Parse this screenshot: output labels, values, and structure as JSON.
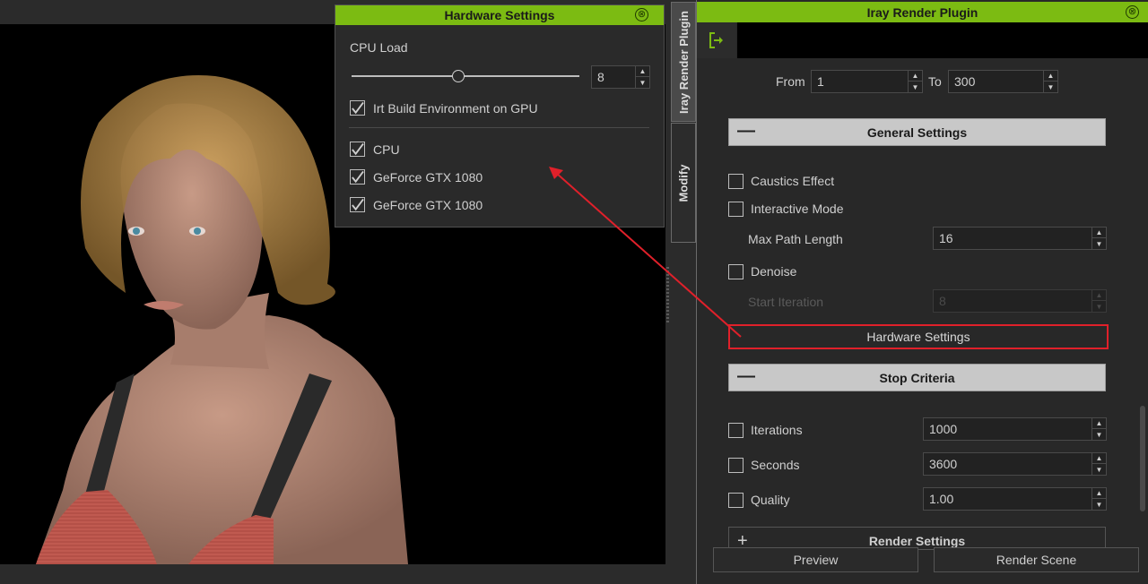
{
  "viewport": {
    "label": "3D viewport"
  },
  "side_tabs": [
    {
      "label": "Iray Render Plugin",
      "active": true
    },
    {
      "label": "Modify",
      "active": false
    }
  ],
  "plugin_panel": {
    "title": "Iray Render Plugin",
    "close_icon": "⊗",
    "exit_icon": "exit-arrow-icon",
    "frame_range": {
      "from_label": "From",
      "from_value": "1",
      "to_label": "To",
      "to_value": "300"
    },
    "general_settings": {
      "title": "General Settings",
      "toggle": "—",
      "caustics_label": "Caustics Effect",
      "caustics_checked": false,
      "interactive_label": "Interactive Mode",
      "interactive_checked": false,
      "max_path_label": "Max Path Length",
      "max_path_value": "16",
      "denoise_label": "Denoise",
      "denoise_checked": false,
      "start_iteration_label": "Start Iteration",
      "start_iteration_value": "8",
      "hardware_button": "Hardware Settings"
    },
    "stop_criteria": {
      "title": "Stop Criteria",
      "toggle": "—",
      "rows": [
        {
          "label": "Iterations",
          "value": "1000",
          "checked": false
        },
        {
          "label": "Seconds",
          "value": "3600",
          "checked": false
        },
        {
          "label": "Quality",
          "value": "1.00",
          "checked": false
        }
      ]
    },
    "render_settings": {
      "title": "Render Settings",
      "toggle": "+"
    },
    "buttons": {
      "preview": "Preview",
      "render_scene": "Render Scene"
    }
  },
  "hardware_dialog": {
    "title": "Hardware Settings",
    "close_icon": "⊗",
    "cpu_load_label": "CPU Load",
    "cpu_load_value": "8",
    "cpu_load_slider_fraction": 0.47,
    "irt_gpu_label": "Irt Build Environment on GPU",
    "irt_gpu_checked": true,
    "devices": [
      {
        "label": "CPU",
        "checked": true
      },
      {
        "label": "GeForce GTX 1080",
        "checked": true
      },
      {
        "label": "GeForce GTX 1080",
        "checked": true
      }
    ]
  },
  "annotation": {
    "color": "#e0202a"
  },
  "colors": {
    "accent": "#7cbb12",
    "panel_bg": "#282828",
    "section_header": "#c8c8c8"
  }
}
